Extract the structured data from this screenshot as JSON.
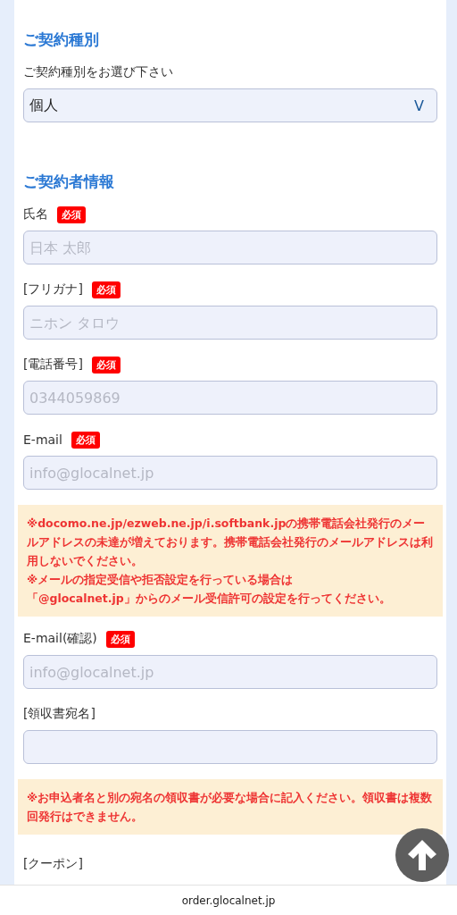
{
  "sections": [
    {
      "heading": "ご契約種別",
      "items": [
        {
          "kind": "select",
          "label": "ご契約種別をお選び下さい",
          "value": "個人",
          "caret": "V"
        }
      ]
    },
    {
      "heading": "ご契約者情報",
      "items": [
        {
          "kind": "field",
          "label": "氏名",
          "badge": "必須",
          "placeholder": "日本 太郎"
        },
        {
          "kind": "field",
          "label": "[フリガナ]",
          "badge": "必須",
          "placeholder": "ニホン タロウ"
        },
        {
          "kind": "field",
          "label": "[電話番号]",
          "badge": "必須",
          "placeholder": "0344059869"
        },
        {
          "kind": "field",
          "label": "E-mail",
          "badge": "必須",
          "placeholder": "info@glocalnet.jp"
        },
        {
          "kind": "notice",
          "paragraphs": [
            "※docomo.ne.jp/ezweb.ne.jp/i.softbank.jpの携帯電話会社発行のメールアドレスの未達が増えております。携帯電話会社発行のメールアドレスは利用しないでください。",
            "※メールの指定受信や拒否設定を行っている場合は",
            "「@glocalnet.jp」からのメール受信許可の設定を行ってください。"
          ]
        },
        {
          "kind": "field",
          "label": "E-mail(確認)",
          "badge": "必須",
          "placeholder": "info@glocalnet.jp"
        },
        {
          "kind": "field",
          "label": "[領収書宛名]"
        },
        {
          "kind": "notice",
          "paragraphs": [
            "※お申込者名と別の宛名の領収書が必要な場合に記入ください。領収書は複数回発行はできません。"
          ]
        },
        {
          "kind": "label",
          "label": "[クーポン]"
        }
      ]
    }
  ],
  "address_bar": {
    "url": "order.glocalnet.jp"
  }
}
